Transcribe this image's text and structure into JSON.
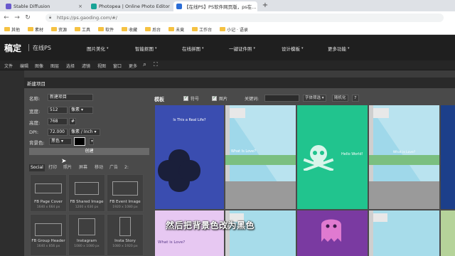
{
  "browser": {
    "tabs": [
      {
        "title": "Stable Diffusion",
        "active": false,
        "fav_color": "#6a5acd"
      },
      {
        "title": "Photopea | Online Photo Editor",
        "active": false,
        "fav_color": "#18a497"
      },
      {
        "title": "【在线PS】PS软件网页版，ps在…",
        "active": true,
        "fav_color": "#2b6dd6"
      }
    ],
    "new_tab": "+",
    "url": "https://ps.gaoding.com/#/",
    "bookmarks": [
      "其他",
      "素材",
      "资源",
      "工具",
      "软件",
      "收藏",
      "后台",
      "未竟",
      "工作台",
      "小记 · 语录"
    ]
  },
  "app": {
    "logo": "稿定",
    "logo_sub": "在线PS",
    "nav": [
      "图片美化",
      "智能抠图",
      "在线拼图",
      "一键证件照",
      "设计模板",
      "更多功能"
    ],
    "menu": [
      "文件",
      "编辑",
      "图像",
      "图层",
      "选择",
      "滤镜",
      "视图",
      "窗口",
      "更多"
    ]
  },
  "dialog": {
    "title": "新建项目",
    "fields": {
      "name_label": "名称:",
      "name_value": "新建项目",
      "width_label": "宽度:",
      "width_value": "512",
      "width_unit": "像素",
      "height_label": "高度:",
      "height_value": "768",
      "height_unit": "#",
      "dpi_label": "DPI:",
      "dpi_value": "72.000",
      "dpi_unit": "像素 / Inch",
      "bg_label": "背景色:",
      "bg_value": "黑色",
      "bg_swatch": "#000000"
    },
    "create_label": "创建",
    "preset_tabs": [
      "Social",
      "打印",
      "照片",
      "屏幕",
      "移动",
      "广告",
      "2:"
    ],
    "presets": [
      {
        "name": "FB Page Cover",
        "size": "1640 x 664 px"
      },
      {
        "name": "FB Shared Image",
        "size": "1200 x 630 px"
      },
      {
        "name": "FB Event Image",
        "size": "1920 x 1080 px"
      },
      {
        "name": "FB Group Header",
        "size": "1640 x 856 px"
      },
      {
        "name": "Instagram",
        "size": "1080 x 1080 px"
      },
      {
        "name": "Insta Story",
        "size": "1080 x 1920 px"
      }
    ]
  },
  "templates": {
    "title": "模板",
    "opt_symbol": "符号",
    "opt_image": "图片",
    "keyword_label": "关键词:",
    "font_filter": "字体筛选",
    "random_label": "随机化",
    "count": "7",
    "cards": [
      {
        "bg": "#3a4db0",
        "text": "Is This a Real Life?"
      },
      {
        "bg": "#7ecfe6",
        "text": ""
      },
      {
        "bg": "#21c48e",
        "text": ""
      },
      {
        "bg": "#7ecfe6",
        "text": ""
      },
      {
        "bg": "#1c3f8a",
        "text": ""
      },
      {
        "bg": "#6fbf8c",
        "text": "What Is Love?"
      },
      {
        "bg": "#1fbc86",
        "text": "Hello World!"
      },
      {
        "bg": "#6fbf8c",
        "text": "What Is Love?"
      },
      {
        "bg": "#e7c8f2",
        "text": "What is Love?"
      },
      {
        "bg": "#7a3aa1",
        "text": ""
      },
      {
        "bg": "#8ed3e8",
        "text": ""
      },
      {
        "bg": "#b5d39a",
        "text": ""
      }
    ]
  },
  "subtitle": "然后把背景色改为黑色"
}
